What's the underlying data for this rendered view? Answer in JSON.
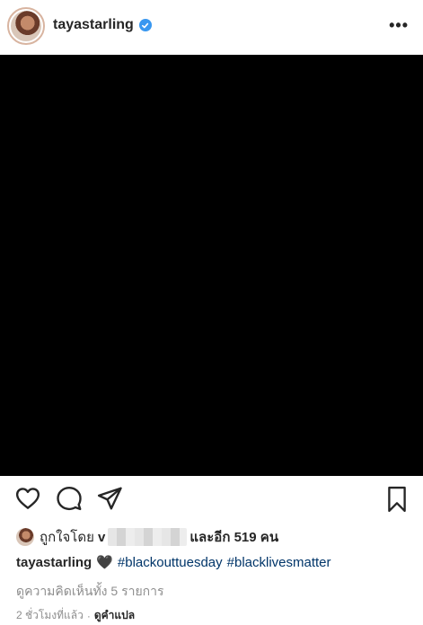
{
  "post": {
    "username": "tayastarling",
    "verified": true,
    "more_label": "•••",
    "photo_color": "#000000"
  },
  "icons": {
    "like": "heart-outline-icon",
    "comment": "comment-bubble-icon",
    "share": "paper-plane-icon",
    "save": "bookmark-icon"
  },
  "likes": {
    "prefix": "ถูกใจโดย",
    "first_letter": "v",
    "suffix_text": "และอีก",
    "count": "519",
    "unit": "คน"
  },
  "caption": {
    "username": "tayastarling",
    "emoji": "🖤",
    "tags": [
      "#blackouttuesday",
      "#blacklivesmatter"
    ]
  },
  "comments_link": "ดูความคิดเห็นทั้ง 5 รายการ",
  "meta": {
    "time": "2 ชั่วโมงที่แล้ว",
    "separator": "·",
    "translate": "ดูคำแปล"
  },
  "colors": {
    "link_blue": "#003569",
    "muted": "#8e8e8e",
    "verified_blue": "#3897f0"
  }
}
